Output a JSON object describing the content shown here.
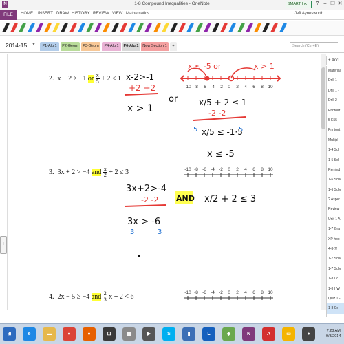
{
  "window": {
    "title": "1-8 Compound Inequalities - OneNote",
    "app_icon": "N",
    "smart_ink": "SMART Ink",
    "controls": [
      "?",
      "–",
      "❐",
      "✕"
    ]
  },
  "ribbon": {
    "file": "FILE",
    "tabs": [
      "HOME",
      "INSERT",
      "DRAW",
      "HISTORY",
      "REVIEW",
      "VIEW",
      "Mathematics"
    ],
    "user": "Jeff Aynesworth"
  },
  "pen_colors": [
    "#222222",
    "#e53935",
    "#43a047",
    "#1e88e5",
    "#8e24aa",
    "#fb8c00",
    "#fdd835",
    "#222222",
    "#e53935",
    "#1e88e5",
    "#43a047",
    "#8e24aa",
    "#fb8c00",
    "#222222",
    "#e53935",
    "#1e88e5",
    "#43a047",
    "#8e24aa",
    "#fb8c00",
    "#fdd835",
    "#222222",
    "#e53935",
    "#1e88e5",
    "#43a047",
    "#8e24aa",
    "#222222",
    "#e53935",
    "#1e88e5",
    "#43a047",
    "#8e24aa",
    "#fb8c00",
    "#222222",
    "#e53935",
    "#1e88e5"
  ],
  "notebook": {
    "name": "2014-15",
    "sections": [
      {
        "label": "P1-Alg 1",
        "color": "#b3cdea"
      },
      {
        "label": "P2-Geom",
        "color": "#b9dc9a"
      },
      {
        "label": "P3-Geom",
        "color": "#f7c796"
      },
      {
        "label": "P4-Alg 1",
        "color": "#e9b3d5"
      },
      {
        "label": "P6-Alg 1",
        "color": "#d9d9d9"
      },
      {
        "label": "New Section 1",
        "color": "#f4a0a0"
      }
    ],
    "add_section": "+",
    "search_placeholder": "Search (Ctrl+E)"
  },
  "problems": [
    {
      "number": "2.",
      "left": "x − 2 > −1",
      "joiner": "or",
      "frac_num": "x",
      "frac_den": "5",
      "right": "+ 2 ≤ 1"
    },
    {
      "number": "3.",
      "left": "3x + 2 > −4",
      "joiner": "and",
      "frac_num": "x",
      "frac_den": "2",
      "right": "+ 2 ≤ 3"
    },
    {
      "number": "4.",
      "left": "2x − 5 ≥ −4",
      "joiner": "and",
      "frac_num": "2",
      "frac_den": "3",
      "right": "x + 2 < 6"
    }
  ],
  "number_line_ticks": [
    "-10",
    "-8",
    "-6",
    "-4",
    "-2",
    "0",
    "2",
    "4",
    "6",
    "8",
    "10"
  ],
  "handwriting": {
    "p2_work": [
      "x-2>-1",
      "+2 +2",
      "x > 1",
      "or"
    ],
    "p2_red": [
      "x ≤ -5 or",
      "x > 1"
    ],
    "p2_second": [
      "x/5 + 2 ≤ 1",
      "-2 -2",
      "x/5 ≤ -1·5",
      "x ≤ -5"
    ],
    "p2_mult": [
      "5",
      "5"
    ],
    "p3_work": [
      "3x+2>-4",
      "-2 -2",
      "3x > -6",
      "3",
      "3"
    ],
    "p3_and": "AND",
    "p3_second": "x/2 + 2 ≤ 3"
  },
  "page_list": {
    "new_page": "+ Add Page",
    "items": [
      "Material",
      "Drill 1 -",
      "Drill 1 -",
      "Drill 2 -",
      "Printout",
      "5 E55",
      "Printout",
      "Multipl",
      "1-4  Sol",
      "1-5  Sol",
      "Remind",
      "1-6 Solv",
      "1-6 Solv",
      "? Asper",
      "Review",
      "Unit 1 A",
      "1-7  Gra",
      "XP-hoo",
      "4-8-7!",
      "1-7 Solv",
      "1-7 Solv",
      "1-8 Co",
      "1-8 HW",
      "Quiz 1 -",
      "1-8 Co"
    ],
    "active_index": 24
  },
  "taskbar": {
    "icons": [
      {
        "name": "start-icon",
        "color": "#2d6bbf",
        "glyph": "⊞"
      },
      {
        "name": "ie-icon",
        "color": "#1e88e5",
        "glyph": "e"
      },
      {
        "name": "folder-icon",
        "color": "#e6b84c",
        "glyph": "▬"
      },
      {
        "name": "chrome-icon",
        "color": "#db4437",
        "glyph": "●"
      },
      {
        "name": "firefox-icon",
        "color": "#e66000",
        "glyph": "●"
      },
      {
        "name": "app-icon",
        "color": "#3a3a3a",
        "glyph": "⊡"
      },
      {
        "name": "calc-icon",
        "color": "#8a8a8a",
        "glyph": "▦"
      },
      {
        "name": "video-icon",
        "color": "#555555",
        "glyph": "▶"
      },
      {
        "name": "skype-icon",
        "color": "#00aff0",
        "glyph": "S"
      },
      {
        "name": "chart-icon",
        "color": "#3b6fb6",
        "glyph": "▮"
      },
      {
        "name": "lync-icon",
        "color": "#1560bd",
        "glyph": "L"
      },
      {
        "name": "smart-icon",
        "color": "#6aa84f",
        "glyph": "◆"
      },
      {
        "name": "onenote-icon",
        "color": "#80397b",
        "glyph": "N"
      },
      {
        "name": "acrobat-icon",
        "color": "#d32f2f",
        "glyph": "A"
      },
      {
        "name": "explorer-icon",
        "color": "#f4b400",
        "glyph": "▭"
      },
      {
        "name": "record-icon",
        "color": "#444444",
        "glyph": "●"
      }
    ],
    "time": "7:28 AM",
    "date": "9/3/2014"
  }
}
